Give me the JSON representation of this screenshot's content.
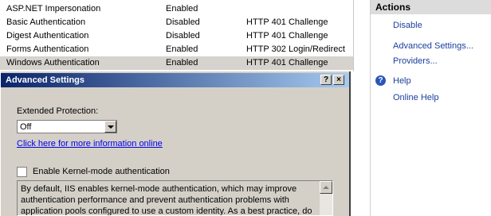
{
  "auth_list": {
    "rows": [
      {
        "name": "ASP.NET Impersonation",
        "status": "Enabled",
        "type": ""
      },
      {
        "name": "Basic Authentication",
        "status": "Disabled",
        "type": "HTTP 401 Challenge"
      },
      {
        "name": "Digest Authentication",
        "status": "Disabled",
        "type": "HTTP 401 Challenge"
      },
      {
        "name": "Forms Authentication",
        "status": "Enabled",
        "type": "HTTP 302 Login/Redirect"
      },
      {
        "name": "Windows Authentication",
        "status": "Enabled",
        "type": "HTTP 401 Challenge"
      }
    ]
  },
  "actions": {
    "header": "Actions",
    "disable": "Disable",
    "advanced_settings": "Advanced Settings...",
    "providers": "Providers...",
    "help": "Help",
    "online_help": "Online Help"
  },
  "dialog": {
    "title": "Advanced Settings",
    "help_button": "?",
    "close_button": "×",
    "extended_protection_label": "Extended Protection:",
    "extended_protection_value": "Off",
    "info_link": "Click here for more information online",
    "kernel_mode_label": "Enable Kernel-mode authentication",
    "kernel_mode_checked": false,
    "description": "By default, IIS enables kernel-mode authentication, which may improve authentication performance and prevent authentication problems with application pools configured to use a custom identity. As a best practice, do"
  },
  "icons": {
    "help": "help-circle-icon",
    "dropdown": "chevron-down-icon",
    "scroll_up": "arrow-up-icon"
  }
}
